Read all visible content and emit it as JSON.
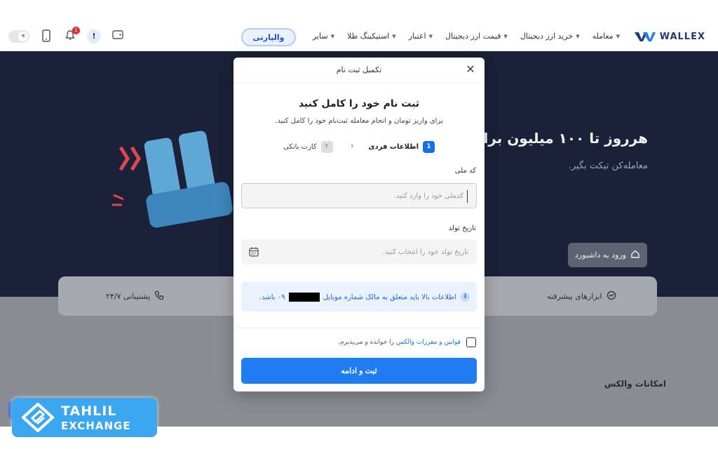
{
  "nav": {
    "brand": "WALLEX",
    "menu": [
      {
        "label": "معامله"
      },
      {
        "label": "خرید ارز دیجیتال"
      },
      {
        "label": "قیمت ارز دیجیتال"
      },
      {
        "label": "اعتبار"
      },
      {
        "label": "استیکینگ طلا"
      },
      {
        "label": "سایر"
      }
    ],
    "promo": "والپارتی",
    "notification_count": "1",
    "alert_icon": "!"
  },
  "hero": {
    "title": "هرروز تا ۱۰۰ میلیون برای",
    "subtitle": "معامله‌کن تیکت بگیر.",
    "dashboard_button": "ورود به داشبورد"
  },
  "features": {
    "support": "پشتیبانی ۲۴/۷",
    "advanced_tools": "ابزارهای پیشرفته"
  },
  "section_title": "امکانات والکس",
  "modal": {
    "header": "تکمیل ثبت نام",
    "title": "ثبت نام خود را کامل کنید",
    "description": "برای واریز تومان و انجام معامله ثبت‌نام خود را کامل کنید.",
    "steps": [
      {
        "number": "1",
        "label": "اطلاعات فردی",
        "active": true
      },
      {
        "number": "۲",
        "label": "کارت بانکی",
        "active": false
      }
    ],
    "national_code": {
      "label": "کد ملی",
      "placeholder": "کدملی خود را وارد کنید."
    },
    "birth_date": {
      "label": "تاریخ تولد",
      "placeholder": "تاریخ تولد خود را انتخاب کنید."
    },
    "notice_before": "اطلاعات بالا باید متعلق به مالک شماره موبایل",
    "notice_after": "۰۹ باشد.",
    "terms_link": "قوانین و مقررات والکس",
    "terms_rest": "را خوانده و می‌پذیرم.",
    "submit": "ثبت و ادامه"
  },
  "watermark": {
    "line1": "TAHLIL",
    "line2": "EXCHANGE"
  },
  "colors": {
    "primary": "#1f7cf1",
    "brand_navy": "#1f3b7a",
    "notice_bg": "#eaf2fe",
    "hero_bg": "#1a2138"
  }
}
